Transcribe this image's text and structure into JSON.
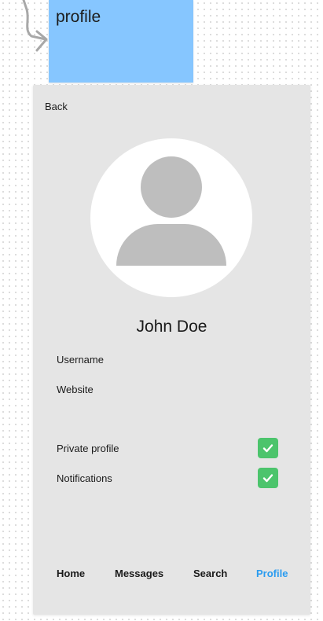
{
  "sticky_note": {
    "text": "profile"
  },
  "screen": {
    "back_label": "Back",
    "user": {
      "name": "John Doe"
    },
    "fields": [
      {
        "label": "Username"
      },
      {
        "label": "Website"
      }
    ],
    "toggles": [
      {
        "label": "Private profile",
        "checked": true
      },
      {
        "label": "Notifications",
        "checked": true
      }
    ],
    "tabs": [
      {
        "label": "Home",
        "active": false
      },
      {
        "label": "Messages",
        "active": false
      },
      {
        "label": "Search",
        "active": false
      },
      {
        "label": "Profile",
        "active": true
      }
    ]
  },
  "colors": {
    "sticky_note": "#86c6ff",
    "frame_background": "#e5e5e5",
    "avatar_placeholder": "#bebebe",
    "checkbox_checked": "#4cc46c",
    "active_tab": "#2a9cf0"
  },
  "icons": {
    "connector": "curved-arrow-icon",
    "avatar": "user-silhouette-icon",
    "checkbox": "checkmark-icon"
  }
}
